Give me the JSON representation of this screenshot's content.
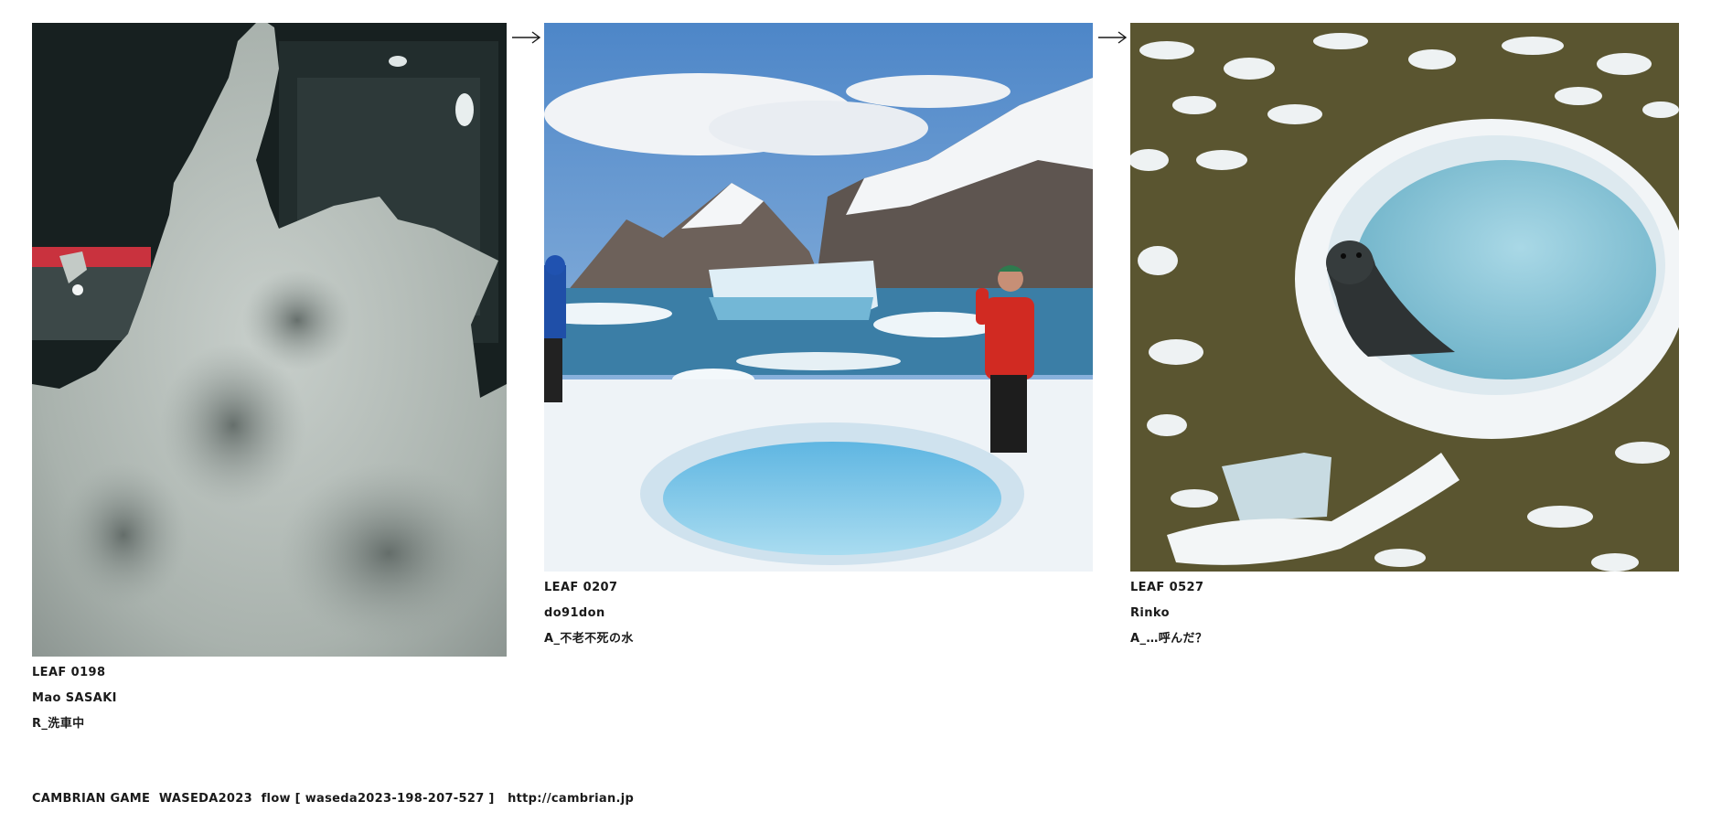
{
  "colors": {
    "text": "#1a1a1a",
    "background": "#ffffff",
    "sky": "#6f9fd3",
    "water": "#8fc9e0",
    "moss": "#5c5a2c",
    "foam": "#b9c0bc"
  },
  "leaves": [
    {
      "leaf_id": "LEAF 0198",
      "author": "Mao SASAKI",
      "title": "R_洗車中",
      "image_icon": "foam-windshield-photo"
    },
    {
      "leaf_id": "LEAF 0207",
      "author": "do91don",
      "title": "A_不老不死の水",
      "image_icon": "arctic-pool-photo"
    },
    {
      "leaf_id": "LEAF 0527",
      "author": "Rinko",
      "title": "A_…呼んだ？",
      "image_icon": "seal-ice-ring-photo"
    }
  ],
  "arrows": [
    "arrow-right-icon",
    "arrow-right-icon"
  ],
  "footer": {
    "text": "CAMBRIAN GAME  WASEDA2023  flow [ waseda2023-198-207-527 ]   ",
    "link": "http://cambrian.jp"
  }
}
